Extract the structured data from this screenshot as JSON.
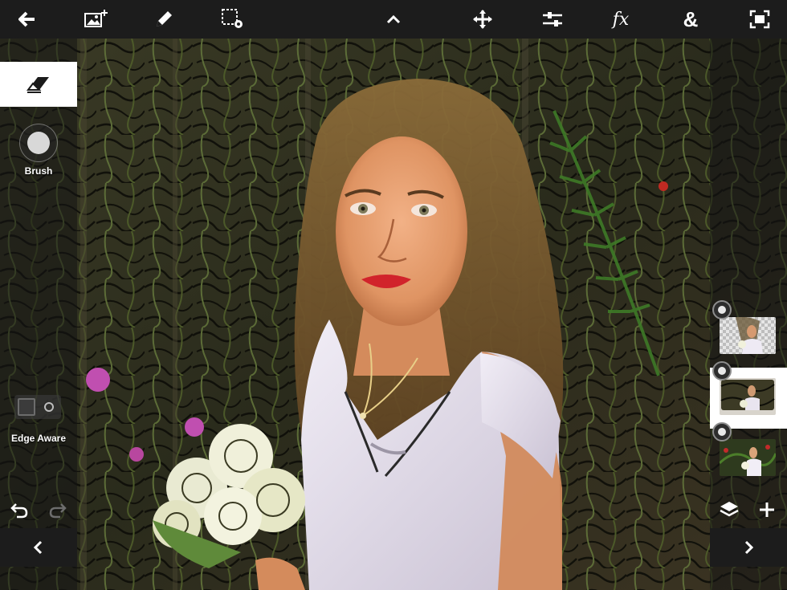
{
  "toolbar": {
    "icons": [
      "back-arrow-icon",
      "add-image-icon",
      "pencil-icon",
      "selection-settings-icon",
      "chevron-up-icon",
      "move-icon",
      "adjustments-icon",
      "fx-icon",
      "ampersand-icon",
      "fit-screen-icon"
    ],
    "fx_label": "fx",
    "amp_label": "&"
  },
  "left_panel": {
    "active_tool_icon": "eraser-icon",
    "brush_label": "Brush",
    "edge_aware_label": "Edge Aware",
    "edge_aware_on": false,
    "undo_icon": "undo-icon",
    "redo_icon": "redo-icon",
    "prev_icon": "chevron-left-icon"
  },
  "right_panel": {
    "layers": [
      {
        "name": "layer-1",
        "selected": false,
        "visible": true
      },
      {
        "name": "layer-2",
        "selected": true,
        "visible": true
      },
      {
        "name": "layer-3",
        "selected": false,
        "visible": true
      }
    ],
    "layers_icon": "layers-icon",
    "add_icon": "plus-icon",
    "next_icon": "chevron-right-icon"
  },
  "colors": {
    "toolbar_bg": "#1c1c1c",
    "panel_selected": "#ffffff",
    "accent_lips": "#d1232b",
    "dress": "#e6e0ec"
  }
}
